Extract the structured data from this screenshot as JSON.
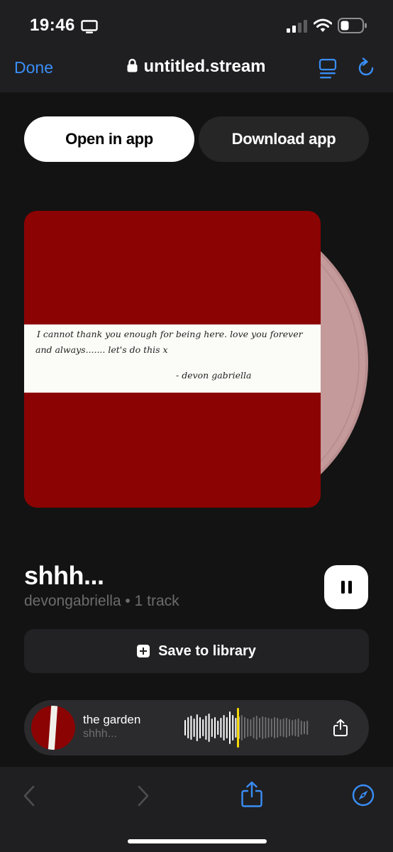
{
  "status_bar": {
    "time": "19:46",
    "screen_icon": "screen-mirroring-icon",
    "signal_icon": "cellular-signal-icon",
    "wifi_icon": "wifi-icon",
    "battery_icon": "battery-icon"
  },
  "nav": {
    "done_label": "Done",
    "url": "untitled.stream",
    "lock_icon": "lock-icon",
    "reader_icon": "reader-mode-icon",
    "reload_icon": "reload-icon"
  },
  "actions": {
    "open_label": "Open in app",
    "download_label": "Download app"
  },
  "cover": {
    "note_line1": "I cannot thank you enough for being here. love you forever",
    "note_line2": "and always....... let's do this x",
    "signature": "- devon gabriella"
  },
  "album": {
    "title": "shhh...",
    "meta": "devongabriella • 1 track"
  },
  "save": {
    "label": "Save to library"
  },
  "player": {
    "track_title": "the garden",
    "track_album": "shhh...",
    "playhead_color": "#f5d90a"
  },
  "colors": {
    "accent": "#3a8ef6",
    "cover_red": "#8b0303",
    "vinyl_pink": "#c49a9a"
  },
  "toolbar": {
    "back_icon": "chevron-left-icon",
    "forward_icon": "chevron-right-icon",
    "share_icon": "share-icon",
    "compass_icon": "compass-icon"
  }
}
